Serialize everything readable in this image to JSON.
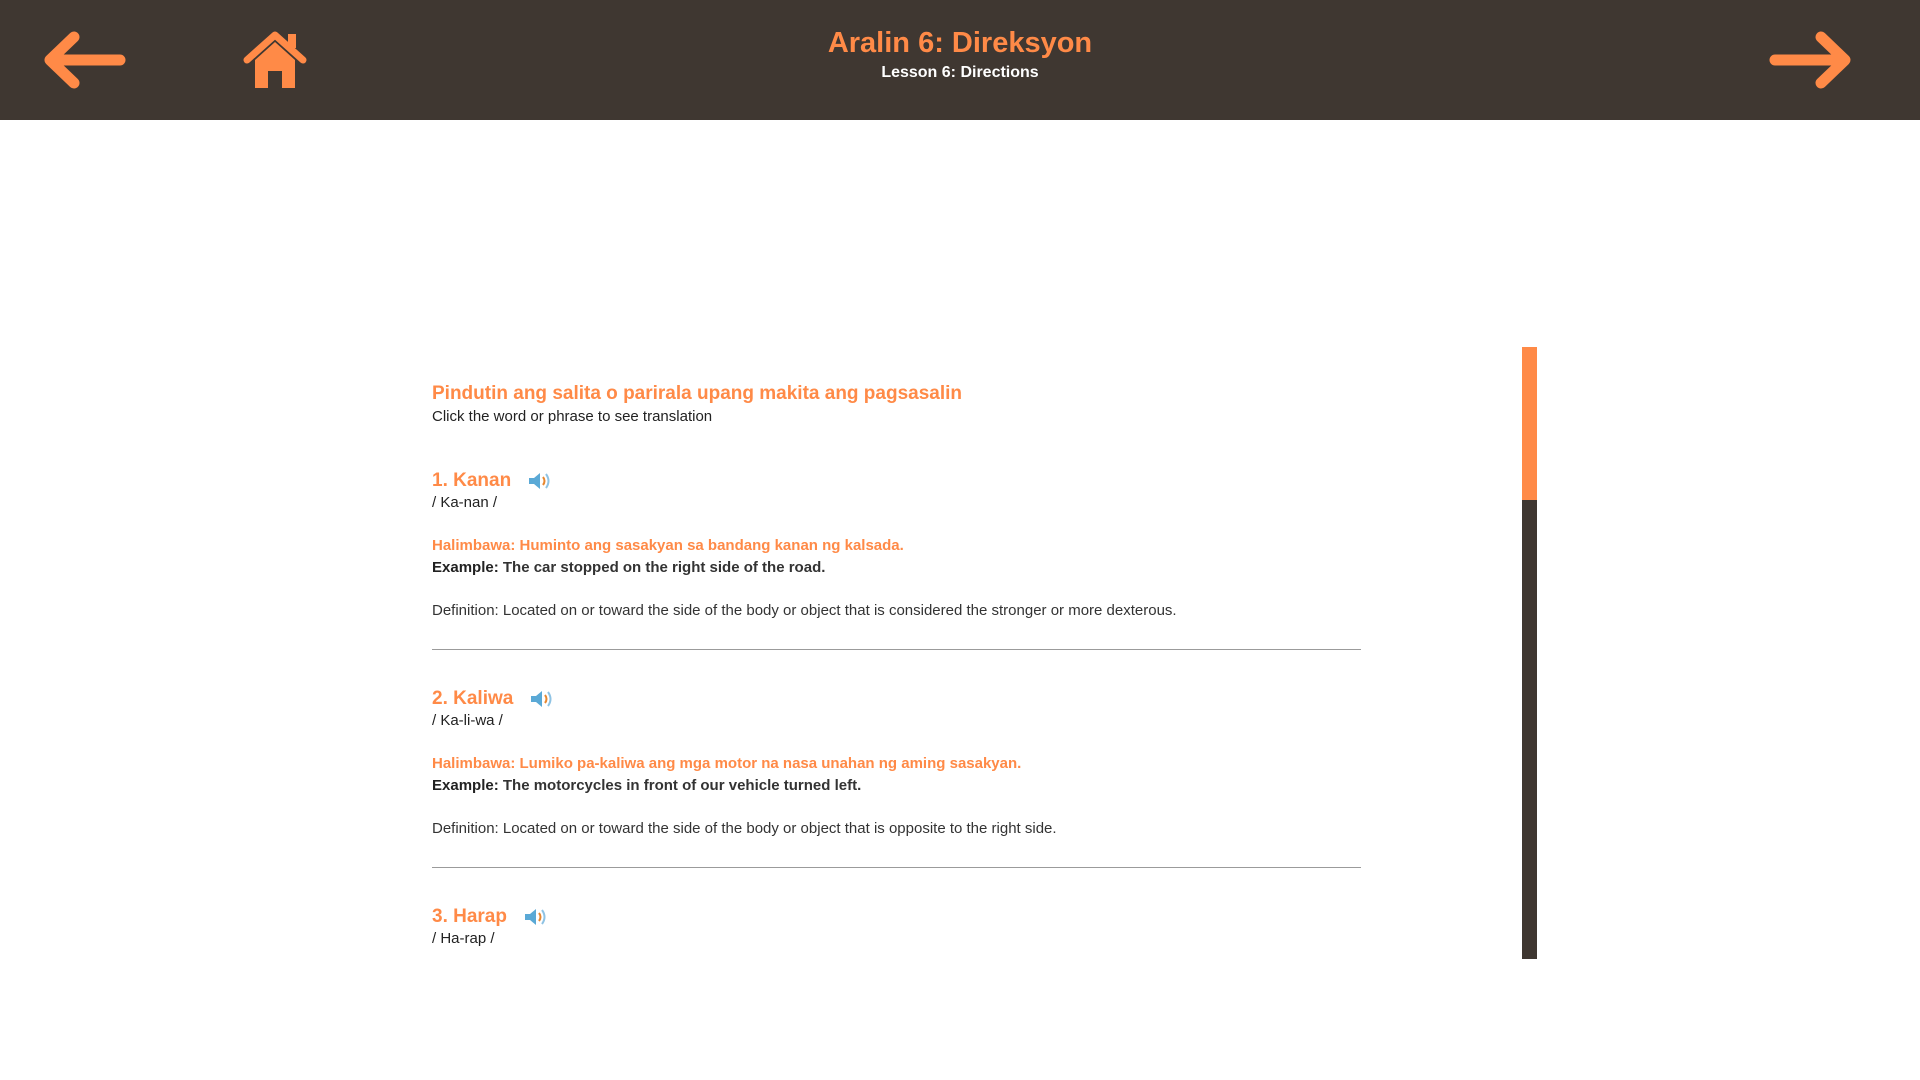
{
  "header": {
    "title": "Aralin 6: Direksyon",
    "subtitle": "Lesson 6: Directions",
    "back_icon": "arrow-left-icon",
    "home_icon": "home-icon",
    "next_icon": "arrow-right-icon"
  },
  "colors": {
    "accent": "#ff8a47",
    "header_bg": "#3f3731",
    "text": "#222222"
  },
  "instructions": {
    "title": "Pindutin ang salita o parirala upang makita ang pagsasalin",
    "subtitle": "Click the word or phrase to see translation"
  },
  "entries": [
    {
      "word": "1. Kanan",
      "pronunciation": "/ Ka-nan /",
      "example_fil": "Halimbawa: Huminto ang sasakyan sa bandang kanan ng kalsada.",
      "example_label": "Example:",
      "example_en": "The car stopped on the right side of the road.",
      "definition": "Definition: Located on or toward the side of the body or object that is considered the stronger or more dexterous."
    },
    {
      "word": "2. Kaliwa",
      "pronunciation": "/ Ka-li-wa /",
      "example_fil": "Halimbawa: Lumiko pa-kaliwa ang mga motor na nasa unahan ng aming sasakyan.",
      "example_label": "Example:",
      "example_en": "The motorcycles in front of our vehicle turned left.",
      "definition": "Definition: Located on or toward the side of the body or object that is opposite to the right side."
    },
    {
      "word": "3. Harap",
      "pronunciation": "/ Ha-rap /"
    }
  ],
  "scroll": {
    "position_fraction": 0.0,
    "visible_fraction": 0.25
  }
}
